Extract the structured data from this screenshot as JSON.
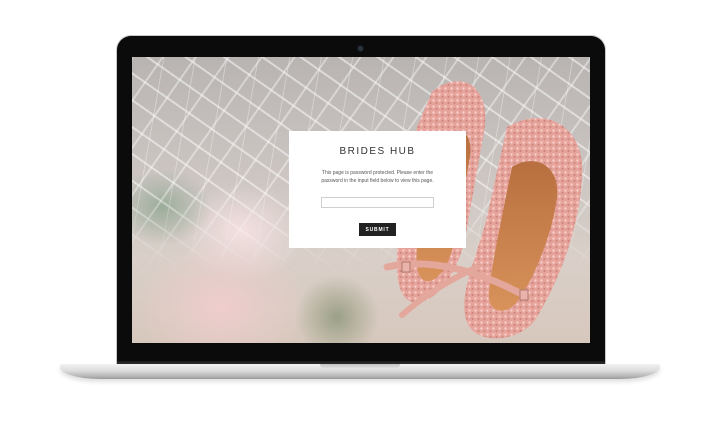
{
  "page": {
    "title": "BRIDES HUB",
    "message": "This page is password protected. Please enter the password in the input field below to view this page.",
    "password_placeholder": "",
    "submit_label": "SUBMIT"
  },
  "colors": {
    "button": "#222222",
    "card": "#ffffff",
    "shoe_pink": "#e9a7a0"
  },
  "icons": {
    "background": "bridal-shoes-photo",
    "camera": "camera-icon"
  }
}
